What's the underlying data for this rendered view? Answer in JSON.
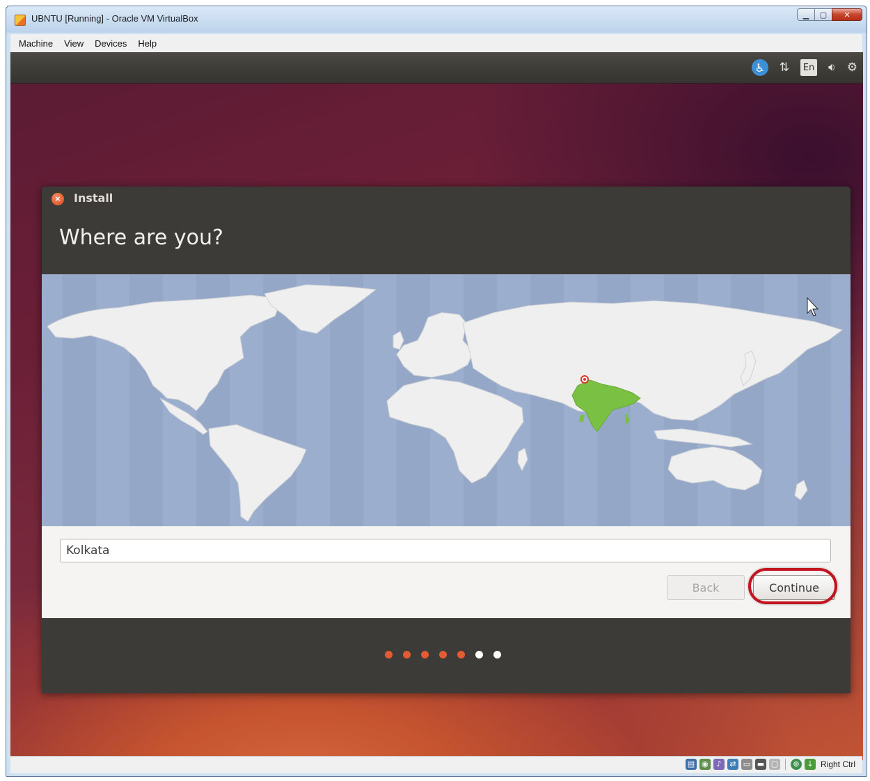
{
  "window": {
    "title": "UBNTU [Running] - Oracle VM VirtualBox",
    "minimize_icon": "minimize-icon",
    "maximize_icon": "maximize-icon",
    "close_icon": "close-icon"
  },
  "menu": {
    "items": [
      "Machine",
      "View",
      "Devices",
      "Help"
    ]
  },
  "top_panel": {
    "indicators": [
      "accessibility-icon",
      "network-icon",
      "keyboard-layout-indicator",
      "volume-icon",
      "settings-gear-icon"
    ],
    "keyboard_layout": "En"
  },
  "dialog": {
    "title": "Install",
    "heading": "Where are you?",
    "selected_region": "India",
    "location_value": "Kolkata",
    "back_label": "Back",
    "continue_label": "Continue",
    "highlight_color": "#c3151f"
  },
  "progress": {
    "total_steps": 7,
    "completed_steps": 5,
    "active_color": "#e35b32",
    "inactive_color": "#ffffff"
  },
  "status_bar": {
    "host_key": "Right Ctrl",
    "icons": [
      "hard-disk-icon",
      "optical-drive-icon",
      "audio-icon",
      "network-adapter-icon",
      "usb-icon",
      "shared-folder-icon",
      "display-icon",
      "capture-icon",
      "mouse-integration-icon"
    ]
  },
  "colors": {
    "ubuntu_orange": "#dd4814",
    "map_ocean": "#9caecd",
    "map_land": "#efefef",
    "map_selected": "#7ac143"
  }
}
